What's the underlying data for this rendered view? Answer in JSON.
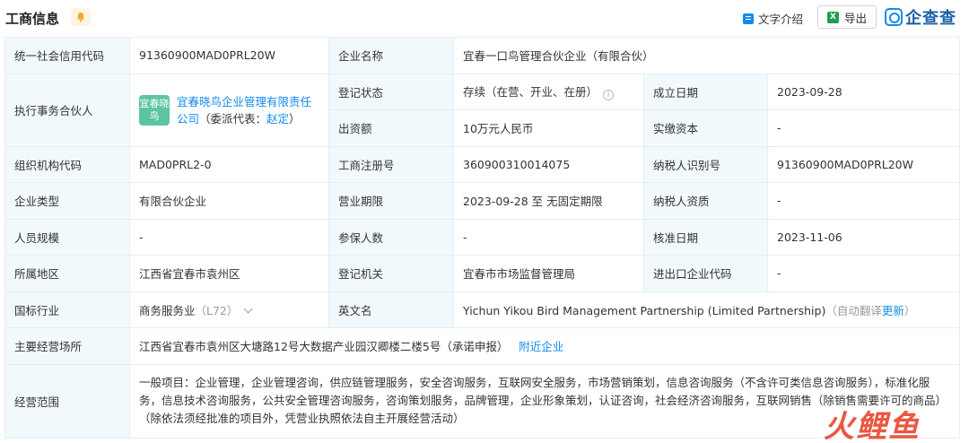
{
  "header": {
    "title": "工商信息",
    "text_intro": "文字介绍",
    "export": "导出",
    "export_icon": "X",
    "logo_text": "企查查"
  },
  "rows": {
    "credit_code_label": "统一社会信用代码",
    "credit_code": "91360900MAD0PRL20W",
    "company_name_label": "企业名称",
    "company_name": "宜春一口鸟管理合伙企业（有限合伙）",
    "exec_partner_label": "执行事务合伙人",
    "exec_partner_avatar": "宜春晓鸟",
    "exec_partner_name": "宜春晓鸟企业管理有限责任公司",
    "exec_partner_rep_prefix": "（委派代表：",
    "exec_partner_rep": "赵定",
    "exec_partner_rep_suffix": "）",
    "reg_status_label": "登记状态",
    "reg_status": "存续（在营、开业、在册）",
    "info_icon": "i",
    "est_date_label": "成立日期",
    "est_date": "2023-09-28",
    "capital_label": "出资额",
    "capital": "10万元人民币",
    "paid_capital_label": "实缴资本",
    "paid_capital": "-",
    "org_code_label": "组织机构代码",
    "org_code": "MAD0PRL2-0",
    "biz_reg_no_label": "工商注册号",
    "biz_reg_no": "360900310014075",
    "taxpayer_id_label": "纳税人识别号",
    "taxpayer_id": "91360900MAD0PRL20W",
    "company_type_label": "企业类型",
    "company_type": "有限合伙企业",
    "biz_term_label": "营业期限",
    "biz_term": "2023-09-28 至 无固定期限",
    "taxpayer_qual_label": "纳税人资质",
    "taxpayer_qual": "-",
    "staff_size_label": "人员规模",
    "staff_size": "-",
    "insured_label": "参保人数",
    "insured": "-",
    "approval_date_label": "核准日期",
    "approval_date": "2023-11-06",
    "region_label": "所属地区",
    "region": "江西省宜春市袁州区",
    "reg_authority_label": "登记机关",
    "reg_authority": "宜春市市场监督管理局",
    "import_export_label": "进出口企业代码",
    "import_export": "-",
    "industry_label": "国标行业",
    "industry": "商务服务业",
    "industry_code": "（L72）",
    "english_name_label": "英文名",
    "english_name": "Yichun Yikou Bird Management Partnership (Limited Partnership)",
    "auto_translate": "（自动翻译",
    "update_link": "更新",
    "auto_translate_close": "）",
    "address_label": "主要经营场所",
    "address": "江西省宜春市袁州区大塘路12号大数据产业园汉卿楼二楼5号（承诺申报）",
    "nearby_link": "附近企业",
    "scope_label": "经营范围",
    "scope": "一般项目：企业管理，企业管理咨询，供应链管理服务，安全咨询服务，互联网安全服务，市场营销策划，信息咨询服务（不含许可类信息咨询服务），标准化服务，信息技术咨询服务，公共安全管理咨询服务，咨询策划服务，品牌管理，企业形象策划，认证咨询，社会经济咨询服务，互联网销售（除销售需要许可的商品）（除依法须经批准的项目外，凭营业执照依法自主开展经营活动）"
  },
  "watermark": "火鲤鱼"
}
